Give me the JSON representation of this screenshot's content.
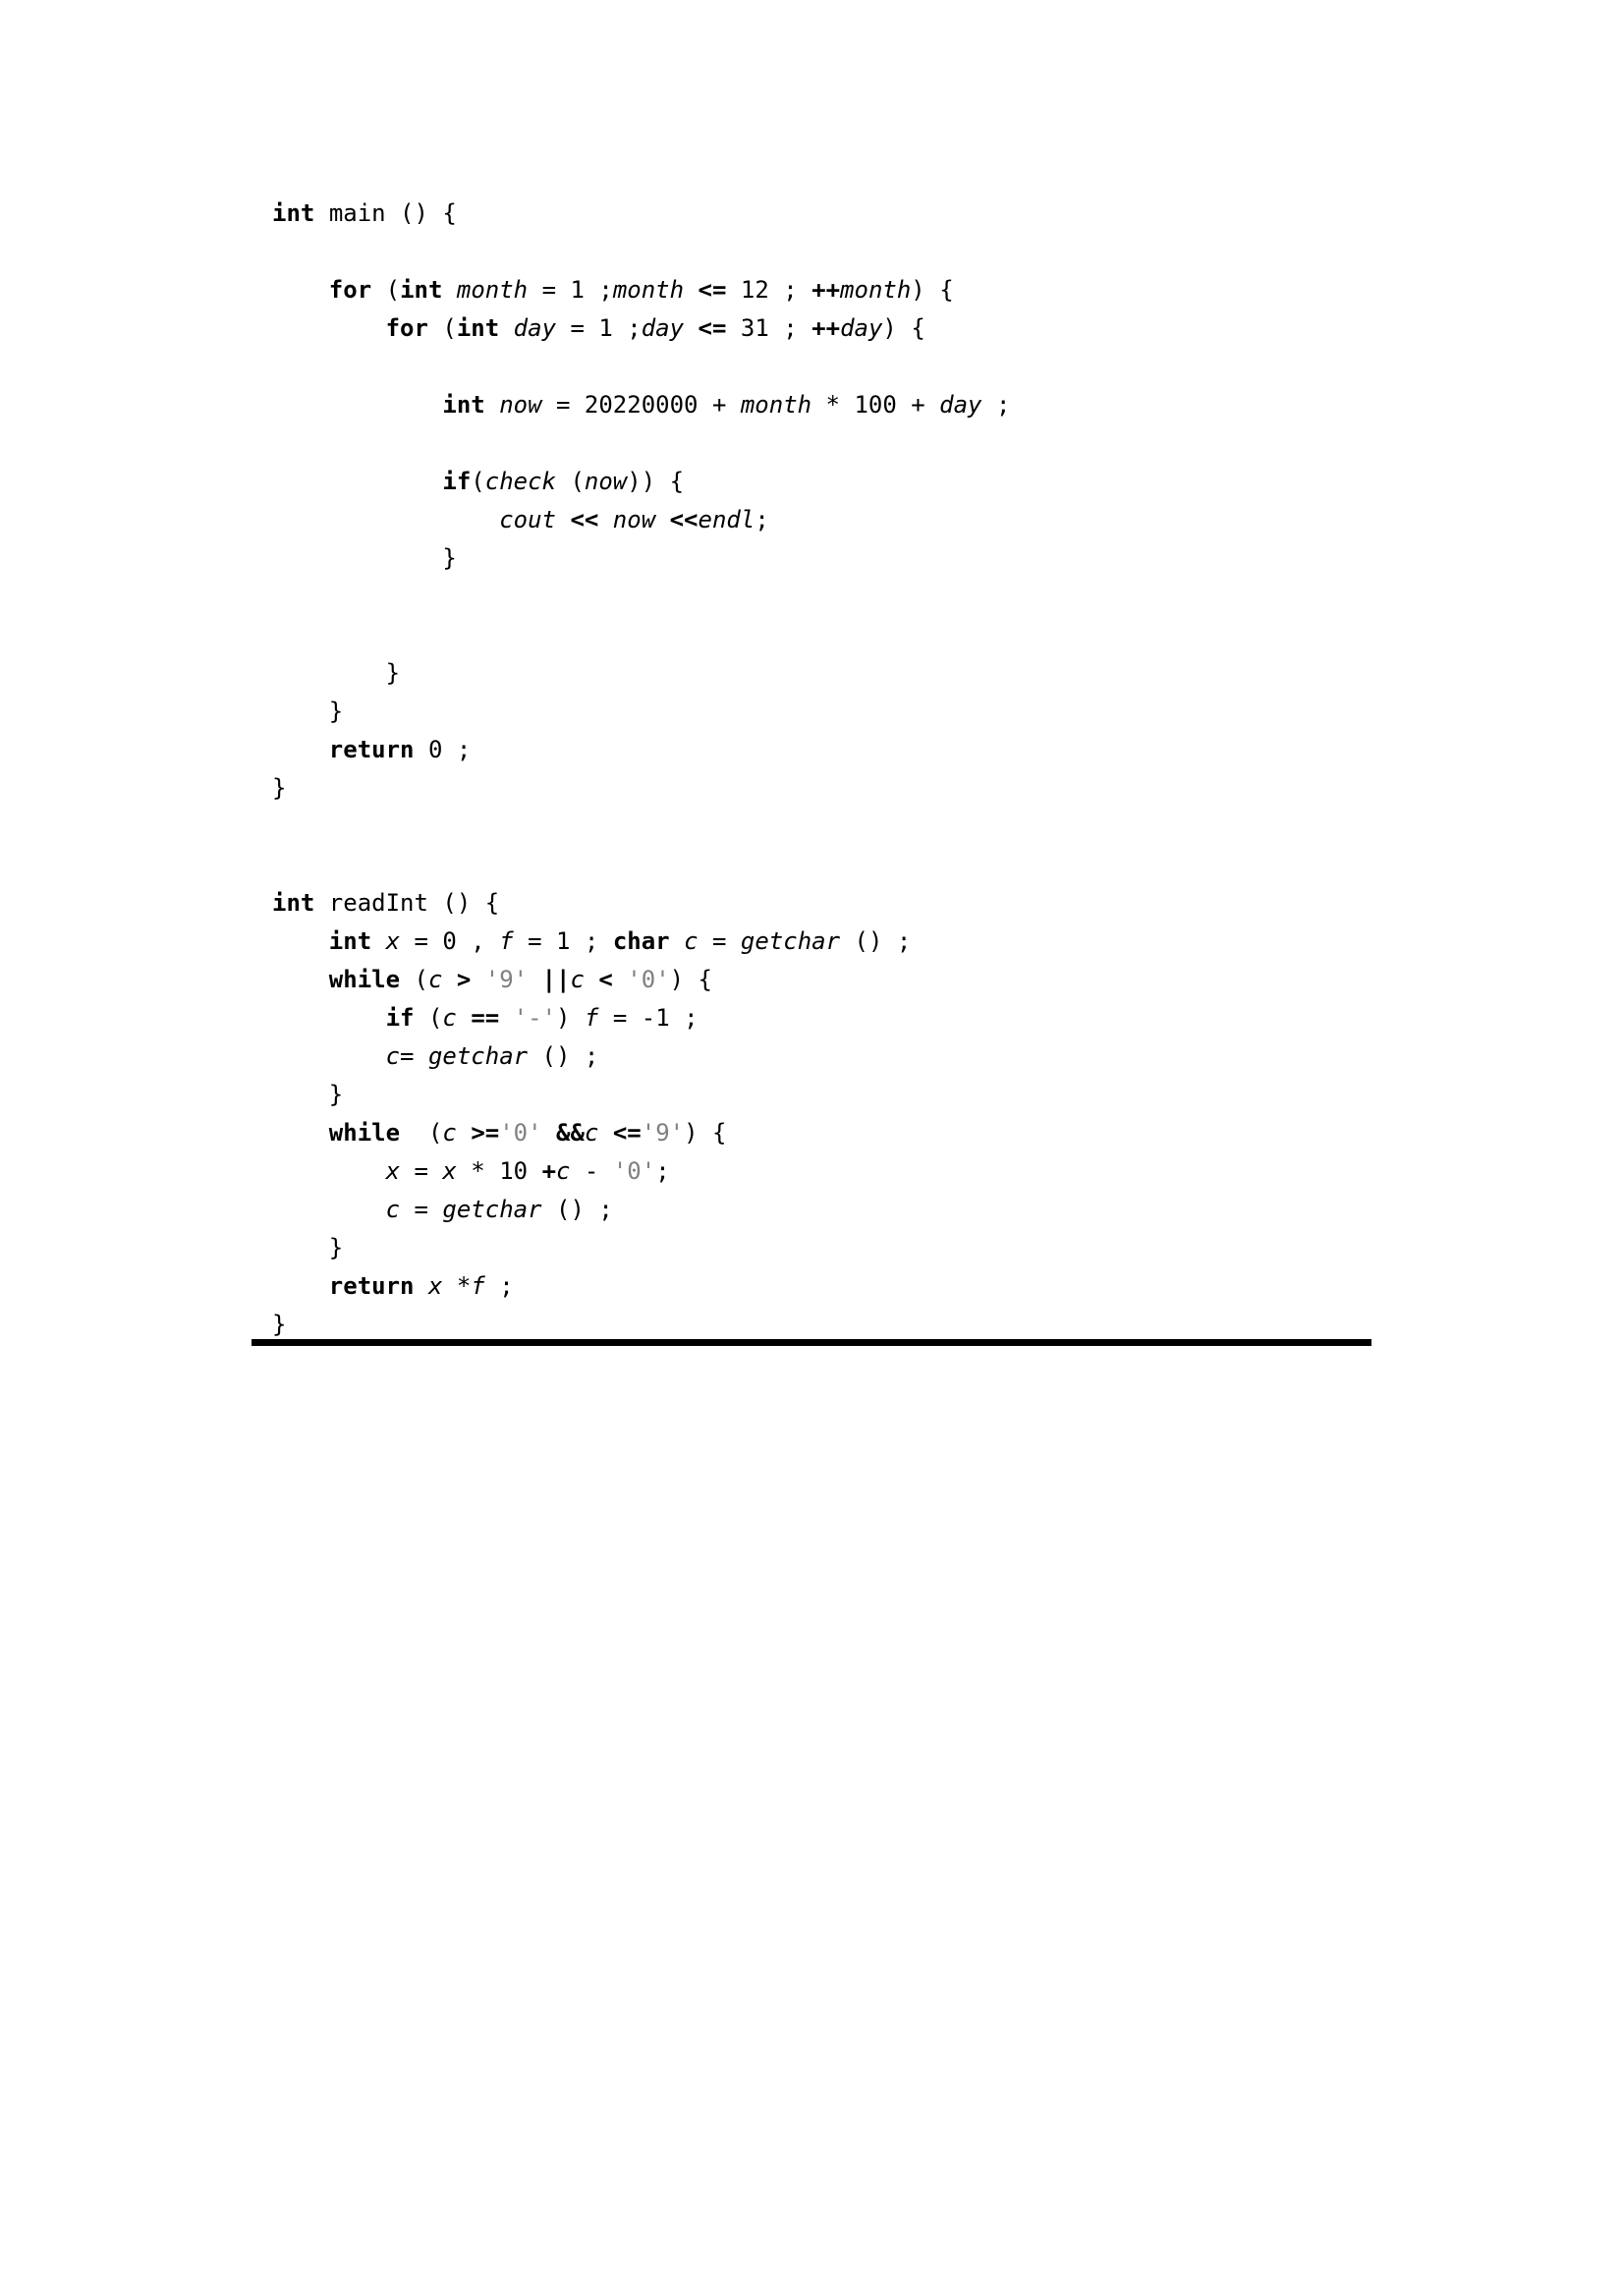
{
  "document": {
    "type": "code-listing",
    "language": "cpp",
    "background_color": "#ffffff",
    "text_color": "#000000",
    "literal_color": "#808080",
    "rule_color": "#000000",
    "lines": [
      {
        "id": "line-1",
        "indent": 0,
        "tokens": [
          {
            "t": "kw",
            "v": "int"
          },
          {
            "t": "pl",
            "v": " "
          },
          {
            "t": "pl",
            "v": "main"
          },
          {
            "t": "pl",
            "v": " () {"
          }
        ]
      },
      {
        "id": "line-2",
        "indent": 0,
        "blank": true,
        "tokens": []
      },
      {
        "id": "line-3",
        "indent": 1,
        "tokens": [
          {
            "t": "kw",
            "v": "for"
          },
          {
            "t": "pl",
            "v": " ("
          },
          {
            "t": "kw",
            "v": "int"
          },
          {
            "t": "pl",
            "v": " "
          },
          {
            "t": "id",
            "v": "month"
          },
          {
            "t": "pl",
            "v": " = 1 ;"
          },
          {
            "t": "id",
            "v": "month"
          },
          {
            "t": "pl",
            "v": " "
          },
          {
            "t": "op",
            "v": "<="
          },
          {
            "t": "pl",
            "v": " 12 ; "
          },
          {
            "t": "op",
            "v": "++"
          },
          {
            "t": "id",
            "v": "month"
          },
          {
            "t": "pl",
            "v": ") {"
          }
        ]
      },
      {
        "id": "line-4",
        "indent": 2,
        "tokens": [
          {
            "t": "kw",
            "v": "for"
          },
          {
            "t": "pl",
            "v": " ("
          },
          {
            "t": "kw",
            "v": "int"
          },
          {
            "t": "pl",
            "v": " "
          },
          {
            "t": "id",
            "v": "day"
          },
          {
            "t": "pl",
            "v": " = 1 ;"
          },
          {
            "t": "id",
            "v": "day"
          },
          {
            "t": "pl",
            "v": " "
          },
          {
            "t": "op",
            "v": "<="
          },
          {
            "t": "pl",
            "v": " 31 ; "
          },
          {
            "t": "op",
            "v": "++"
          },
          {
            "t": "id",
            "v": "day"
          },
          {
            "t": "pl",
            "v": ") {"
          }
        ]
      },
      {
        "id": "line-5",
        "indent": 0,
        "blank": true,
        "tokens": []
      },
      {
        "id": "line-6",
        "indent": 3,
        "tokens": [
          {
            "t": "kw",
            "v": "int"
          },
          {
            "t": "pl",
            "v": " "
          },
          {
            "t": "id",
            "v": "now"
          },
          {
            "t": "pl",
            "v": " = 20220000 + "
          },
          {
            "t": "id",
            "v": "month"
          },
          {
            "t": "pl",
            "v": " * 100 + "
          },
          {
            "t": "id",
            "v": "day"
          },
          {
            "t": "pl",
            "v": " ;"
          }
        ]
      },
      {
        "id": "line-7",
        "indent": 0,
        "blank": true,
        "tokens": []
      },
      {
        "id": "line-8",
        "indent": 3,
        "tokens": [
          {
            "t": "kw",
            "v": "if"
          },
          {
            "t": "pl",
            "v": "("
          },
          {
            "t": "id",
            "v": "check"
          },
          {
            "t": "pl",
            "v": " ("
          },
          {
            "t": "id",
            "v": "now"
          },
          {
            "t": "pl",
            "v": ")) {"
          }
        ]
      },
      {
        "id": "line-9",
        "indent": 4,
        "tokens": [
          {
            "t": "id",
            "v": "cout"
          },
          {
            "t": "pl",
            "v": " "
          },
          {
            "t": "op",
            "v": "<<"
          },
          {
            "t": "pl",
            "v": " "
          },
          {
            "t": "id",
            "v": "now"
          },
          {
            "t": "pl",
            "v": " "
          },
          {
            "t": "op",
            "v": "<<"
          },
          {
            "t": "id",
            "v": "endl"
          },
          {
            "t": "pl",
            "v": ";"
          }
        ]
      },
      {
        "id": "line-10",
        "indent": 3,
        "tokens": [
          {
            "t": "pl",
            "v": "}"
          }
        ]
      },
      {
        "id": "line-11",
        "indent": 0,
        "blank": true,
        "tokens": []
      },
      {
        "id": "line-12",
        "indent": 0,
        "blank": true,
        "tokens": []
      },
      {
        "id": "line-13",
        "indent": 2,
        "tokens": [
          {
            "t": "pl",
            "v": "}"
          }
        ]
      },
      {
        "id": "line-14",
        "indent": 1,
        "tokens": [
          {
            "t": "pl",
            "v": "}"
          }
        ]
      },
      {
        "id": "line-15",
        "indent": 1,
        "tokens": [
          {
            "t": "kw",
            "v": "return"
          },
          {
            "t": "pl",
            "v": " 0 ;"
          }
        ]
      },
      {
        "id": "line-16",
        "indent": 0,
        "tokens": [
          {
            "t": "pl",
            "v": "}"
          }
        ]
      },
      {
        "id": "line-17",
        "indent": 0,
        "blank": true,
        "tokens": []
      },
      {
        "id": "line-18",
        "indent": 0,
        "blank": true,
        "tokens": []
      },
      {
        "id": "line-19",
        "indent": 0,
        "tokens": [
          {
            "t": "kw",
            "v": "int"
          },
          {
            "t": "pl",
            "v": " readInt () {"
          }
        ]
      },
      {
        "id": "line-20",
        "indent": 1,
        "tokens": [
          {
            "t": "kw",
            "v": "int"
          },
          {
            "t": "pl",
            "v": " "
          },
          {
            "t": "id",
            "v": "x"
          },
          {
            "t": "pl",
            "v": " = 0 , "
          },
          {
            "t": "id",
            "v": "f"
          },
          {
            "t": "pl",
            "v": " = 1 ; "
          },
          {
            "t": "kw",
            "v": "char"
          },
          {
            "t": "pl",
            "v": " "
          },
          {
            "t": "id",
            "v": "c"
          },
          {
            "t": "pl",
            "v": " = "
          },
          {
            "t": "id",
            "v": "getchar"
          },
          {
            "t": "pl",
            "v": " () ;"
          }
        ]
      },
      {
        "id": "line-21",
        "indent": 1,
        "tokens": [
          {
            "t": "kw",
            "v": "while"
          },
          {
            "t": "pl",
            "v": " ("
          },
          {
            "t": "id",
            "v": "c"
          },
          {
            "t": "pl",
            "v": " "
          },
          {
            "t": "op",
            "v": ">"
          },
          {
            "t": "pl",
            "v": " "
          },
          {
            "t": "str",
            "v": "'9'"
          },
          {
            "t": "pl",
            "v": " "
          },
          {
            "t": "op",
            "v": "||"
          },
          {
            "t": "id",
            "v": "c"
          },
          {
            "t": "pl",
            "v": " "
          },
          {
            "t": "op",
            "v": "<"
          },
          {
            "t": "pl",
            "v": " "
          },
          {
            "t": "str",
            "v": "'0'"
          },
          {
            "t": "pl",
            "v": ") {"
          }
        ]
      },
      {
        "id": "line-22",
        "indent": 2,
        "tokens": [
          {
            "t": "kw",
            "v": "if"
          },
          {
            "t": "pl",
            "v": " ("
          },
          {
            "t": "id",
            "v": "c"
          },
          {
            "t": "pl",
            "v": " "
          },
          {
            "t": "op",
            "v": "=="
          },
          {
            "t": "pl",
            "v": " "
          },
          {
            "t": "str",
            "v": "'-'"
          },
          {
            "t": "pl",
            "v": ") "
          },
          {
            "t": "id",
            "v": "f"
          },
          {
            "t": "pl",
            "v": " = -1 ;"
          }
        ]
      },
      {
        "id": "line-23",
        "indent": 2,
        "tokens": [
          {
            "t": "id",
            "v": "c"
          },
          {
            "t": "pl",
            "v": "= "
          },
          {
            "t": "id",
            "v": "getchar"
          },
          {
            "t": "pl",
            "v": " () ;"
          }
        ]
      },
      {
        "id": "line-24",
        "indent": 1,
        "tokens": [
          {
            "t": "pl",
            "v": "}"
          }
        ]
      },
      {
        "id": "line-25",
        "indent": 1,
        "tokens": [
          {
            "t": "kw",
            "v": "while"
          },
          {
            "t": "pl",
            "v": "  ("
          },
          {
            "t": "id",
            "v": "c"
          },
          {
            "t": "pl",
            "v": " "
          },
          {
            "t": "op",
            "v": ">="
          },
          {
            "t": "str",
            "v": "'0'"
          },
          {
            "t": "pl",
            "v": " "
          },
          {
            "t": "op",
            "v": "&&"
          },
          {
            "t": "id",
            "v": "c"
          },
          {
            "t": "pl",
            "v": " "
          },
          {
            "t": "op",
            "v": "<="
          },
          {
            "t": "str",
            "v": "'9'"
          },
          {
            "t": "pl",
            "v": ") {"
          }
        ]
      },
      {
        "id": "line-26",
        "indent": 2,
        "tokens": [
          {
            "t": "id",
            "v": "x"
          },
          {
            "t": "pl",
            "v": " = "
          },
          {
            "t": "id",
            "v": "x"
          },
          {
            "t": "pl",
            "v": " * 10 "
          },
          {
            "t": "op",
            "v": "+"
          },
          {
            "t": "id",
            "v": "c"
          },
          {
            "t": "pl",
            "v": " - "
          },
          {
            "t": "str",
            "v": "'0'"
          },
          {
            "t": "pl",
            "v": ";"
          }
        ]
      },
      {
        "id": "line-27",
        "indent": 2,
        "tokens": [
          {
            "t": "id",
            "v": "c"
          },
          {
            "t": "pl",
            "v": " = "
          },
          {
            "t": "id",
            "v": "getchar"
          },
          {
            "t": "pl",
            "v": " () ;"
          }
        ]
      },
      {
        "id": "line-28",
        "indent": 1,
        "tokens": [
          {
            "t": "pl",
            "v": "}"
          }
        ]
      },
      {
        "id": "line-29",
        "indent": 1,
        "tokens": [
          {
            "t": "kw",
            "v": "return"
          },
          {
            "t": "pl",
            "v": " "
          },
          {
            "t": "id",
            "v": "x"
          },
          {
            "t": "pl",
            "v": " *"
          },
          {
            "t": "id",
            "v": "f"
          },
          {
            "t": "pl",
            "v": " ;"
          }
        ]
      },
      {
        "id": "line-30",
        "indent": 0,
        "tokens": [
          {
            "t": "pl",
            "v": "}"
          }
        ]
      }
    ]
  }
}
